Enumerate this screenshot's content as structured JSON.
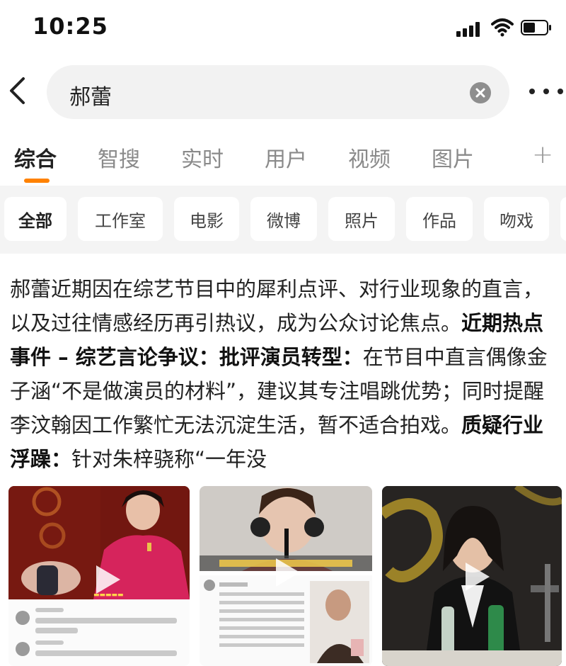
{
  "status_bar": {
    "time": "10:25"
  },
  "search": {
    "query": "郝蕾"
  },
  "main_tabs": [
    {
      "label": "综合"
    },
    {
      "label": "智搜"
    },
    {
      "label": "实时"
    },
    {
      "label": "用户"
    },
    {
      "label": "视频"
    },
    {
      "label": "图片"
    }
  ],
  "main_tabs_more": "+",
  "chips": [
    {
      "label": "全部"
    },
    {
      "label": "工作室"
    },
    {
      "label": "电影"
    },
    {
      "label": "微博"
    },
    {
      "label": "照片"
    },
    {
      "label": "作品"
    },
    {
      "label": "吻戏"
    }
  ],
  "summary": {
    "intro": "郝蕾近期因在综艺节目中的犀利点评、对行业现象的直言，以及过往情感经历再引热议，成为公众讨论焦点。",
    "section_heading": "近期热点事件 – 综艺言论争议：",
    "point1_heading": "批评演员转型：",
    "point1_text": "在节目中直言偶像金子涵“不是做演员的材料”，建议其专注唱跳优势；同时提醒李汶翰因工作繁忙无法沉淀生活，暂不适合拍戏。",
    "point2_heading": "质疑行业浮躁：",
    "point2_text": "针对朱梓骁称“一年没"
  },
  "colors": {
    "accent": "#ff8200",
    "chip_bg": "#f4f4f4",
    "search_bg": "#f2f2f2"
  },
  "icons": {
    "back": "chevron-left-icon",
    "clear": "clear-icon",
    "more": "more-icon",
    "play": "play-icon"
  }
}
